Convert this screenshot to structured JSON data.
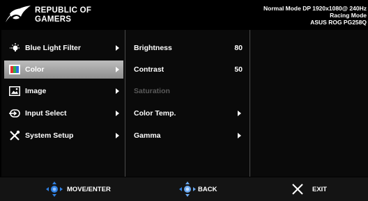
{
  "brand": {
    "line1": "REPUBLIC OF",
    "line2": "GAMERS"
  },
  "status": {
    "mode_line": "Normal Mode DP 1920x1080@ 240Hz",
    "preset": "Racing Mode",
    "model": "ASUS ROG PG258Q"
  },
  "main_menu": [
    {
      "label": "Blue Light Filter",
      "icon": "lightbulb-icon"
    },
    {
      "label": "Color",
      "icon": "color-icon",
      "selected": true
    },
    {
      "label": "Image",
      "icon": "image-icon"
    },
    {
      "label": "Input Select",
      "icon": "input-icon"
    },
    {
      "label": "System Setup",
      "icon": "wrench-icon"
    }
  ],
  "submenu": [
    {
      "label": "Brightness",
      "value": "80"
    },
    {
      "label": "Contrast",
      "value": "50"
    },
    {
      "label": "Saturation",
      "disabled": true
    },
    {
      "label": "Color Temp."
    },
    {
      "label": "Gamma"
    }
  ],
  "footer": {
    "move_enter": "MOVE/ENTER",
    "back": "BACK",
    "exit": "EXIT"
  },
  "colors": {
    "accent_blue": "#2f7fe0",
    "selected_bg": "#a8a8a8"
  }
}
